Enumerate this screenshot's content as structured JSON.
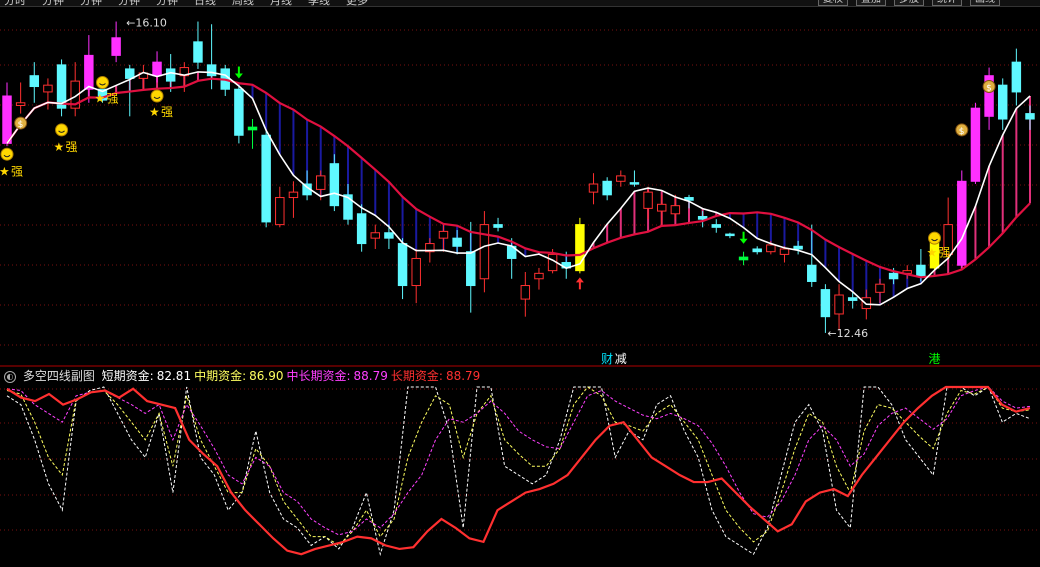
{
  "toolbar": {
    "left_items": [
      "分时",
      "分钟",
      "分钟",
      "分钟",
      "分钟",
      "日线",
      "周线",
      "月线",
      "季线",
      "更多"
    ],
    "right_items": [
      "复权",
      "叠加",
      "多股",
      "统计",
      "画线"
    ]
  },
  "main_panel": {
    "candles": [
      {
        "o": 135,
        "h": 145,
        "l": 98,
        "c": 100,
        "color": "magenta",
        "fill": true
      },
      {
        "o": 130,
        "h": 145,
        "l": 122,
        "c": 128,
        "color": "red",
        "fill": false
      },
      {
        "o": 142,
        "h": 160,
        "l": 130,
        "c": 150,
        "color": "cyan",
        "fill": true
      },
      {
        "o": 138,
        "h": 148,
        "l": 125,
        "c": 143,
        "color": "red",
        "fill": false
      },
      {
        "o": 158,
        "h": 162,
        "l": 120,
        "c": 126,
        "color": "cyan",
        "fill": true
      },
      {
        "o": 146,
        "h": 160,
        "l": 120,
        "c": 126,
        "color": "red",
        "fill": false
      },
      {
        "o": 140,
        "h": 180,
        "l": 130,
        "c": 165,
        "color": "magenta",
        "fill": true
      },
      {
        "o": 140,
        "h": 148,
        "l": 130,
        "c": 132,
        "color": "cyan",
        "fill": true
      },
      {
        "o": 178,
        "h": 190,
        "l": 160,
        "c": 165,
        "color": "magenta",
        "fill": true
      },
      {
        "o": 155,
        "h": 158,
        "l": 120,
        "c": 148,
        "color": "cyan",
        "fill": true
      },
      {
        "o": 148,
        "h": 158,
        "l": 140,
        "c": 152,
        "color": "red",
        "fill": false
      },
      {
        "o": 160,
        "h": 168,
        "l": 145,
        "c": 150,
        "color": "magenta",
        "fill": true
      },
      {
        "o": 155,
        "h": 166,
        "l": 138,
        "c": 146,
        "color": "cyan",
        "fill": true
      },
      {
        "o": 150,
        "h": 160,
        "l": 138,
        "c": 156,
        "color": "red",
        "fill": false
      },
      {
        "o": 175,
        "h": 190,
        "l": 155,
        "c": 160,
        "color": "cyan",
        "fill": true
      },
      {
        "o": 158,
        "h": 188,
        "l": 140,
        "c": 150,
        "color": "cyan",
        "fill": true
      },
      {
        "o": 155,
        "h": 158,
        "l": 135,
        "c": 140,
        "color": "cyan",
        "fill": true
      },
      {
        "o": 140,
        "h": 142,
        "l": 100,
        "c": 106,
        "color": "cyan",
        "fill": true
      },
      {
        "o": 112,
        "h": 118,
        "l": 96,
        "c": 110,
        "color": "green",
        "fill": true
      },
      {
        "o": 106,
        "h": 110,
        "l": 38,
        "c": 42,
        "color": "cyan",
        "fill": true
      },
      {
        "o": 40,
        "h": 68,
        "l": 38,
        "c": 60,
        "color": "red",
        "fill": false
      },
      {
        "o": 60,
        "h": 72,
        "l": 45,
        "c": 64,
        "color": "red",
        "fill": false
      },
      {
        "o": 70,
        "h": 80,
        "l": 58,
        "c": 62,
        "color": "cyan",
        "fill": true
      },
      {
        "o": 66,
        "h": 80,
        "l": 58,
        "c": 76,
        "color": "red",
        "fill": false
      },
      {
        "o": 85,
        "h": 92,
        "l": 50,
        "c": 54,
        "color": "cyan",
        "fill": true
      },
      {
        "o": 62,
        "h": 70,
        "l": 40,
        "c": 44,
        "color": "cyan",
        "fill": true
      },
      {
        "o": 48,
        "h": 55,
        "l": 20,
        "c": 26,
        "color": "cyan",
        "fill": true
      },
      {
        "o": 30,
        "h": 40,
        "l": 22,
        "c": 34,
        "color": "red",
        "fill": false
      },
      {
        "o": 30,
        "h": 40,
        "l": 22,
        "c": 34,
        "color": "cyan",
        "fill": true
      },
      {
        "o": 26,
        "h": 30,
        "l": -15,
        "c": -5,
        "color": "cyan",
        "fill": true
      },
      {
        "o": -5,
        "h": 22,
        "l": -18,
        "c": 15,
        "color": "red",
        "fill": false
      },
      {
        "o": 20,
        "h": 30,
        "l": 12,
        "c": 26,
        "color": "red",
        "fill": false
      },
      {
        "o": 30,
        "h": 40,
        "l": 20,
        "c": 35,
        "color": "red",
        "fill": false
      },
      {
        "o": 30,
        "h": 36,
        "l": 18,
        "c": 24,
        "color": "cyan",
        "fill": true
      },
      {
        "o": 20,
        "h": 42,
        "l": -25,
        "c": -5,
        "color": "cyan",
        "fill": true
      },
      {
        "o": 0,
        "h": 50,
        "l": -10,
        "c": 40,
        "color": "red",
        "fill": false
      },
      {
        "o": 40,
        "h": 45,
        "l": 35,
        "c": 38,
        "color": "cyan",
        "fill": true
      },
      {
        "o": 15,
        "h": 30,
        "l": 0,
        "c": 24,
        "color": "cyan",
        "fill": true
      },
      {
        "o": -5,
        "h": 5,
        "l": -28,
        "c": -15,
        "color": "red",
        "fill": false
      },
      {
        "o": 0,
        "h": 8,
        "l": -8,
        "c": 4,
        "color": "red",
        "fill": false
      },
      {
        "o": 6,
        "h": 22,
        "l": 4,
        "c": 18,
        "color": "red",
        "fill": false
      },
      {
        "o": 12,
        "h": 20,
        "l": 0,
        "c": 8,
        "color": "cyan",
        "fill": true
      },
      {
        "o": 6,
        "h": 45,
        "l": 4,
        "c": 40,
        "color": "yellow",
        "fill": true
      },
      {
        "o": 70,
        "h": 78,
        "l": 55,
        "c": 64,
        "color": "red",
        "fill": false
      },
      {
        "o": 62,
        "h": 75,
        "l": 58,
        "c": 72,
        "color": "cyan",
        "fill": true
      },
      {
        "o": 72,
        "h": 80,
        "l": 68,
        "c": 76,
        "color": "red",
        "fill": false
      },
      {
        "o": 70,
        "h": 80,
        "l": 68,
        "c": 71,
        "color": "cyan",
        "fill": true
      },
      {
        "o": 64,
        "h": 68,
        "l": 44,
        "c": 52,
        "color": "red",
        "fill": false
      },
      {
        "o": 50,
        "h": 62,
        "l": 40,
        "c": 55,
        "color": "red",
        "fill": false
      },
      {
        "o": 54,
        "h": 62,
        "l": 44,
        "c": 48,
        "color": "red",
        "fill": false
      },
      {
        "o": 58,
        "h": 62,
        "l": 52,
        "c": 60,
        "color": "cyan",
        "fill": true
      },
      {
        "o": 46,
        "h": 50,
        "l": 38,
        "c": 44,
        "color": "cyan",
        "fill": true
      },
      {
        "o": 40,
        "h": 44,
        "l": 34,
        "c": 38,
        "color": "cyan",
        "fill": true
      },
      {
        "o": 32,
        "h": 34,
        "l": 30,
        "c": 33,
        "color": "cyan",
        "fill": true
      },
      {
        "o": 16,
        "h": 20,
        "l": 10,
        "c": 14,
        "color": "green",
        "fill": true
      },
      {
        "o": 22,
        "h": 24,
        "l": 18,
        "c": 20,
        "color": "cyan",
        "fill": true
      },
      {
        "o": 20,
        "h": 28,
        "l": 18,
        "c": 25,
        "color": "red",
        "fill": false
      },
      {
        "o": 18,
        "h": 24,
        "l": 12,
        "c": 22,
        "color": "red",
        "fill": false
      },
      {
        "o": 22,
        "h": 28,
        "l": 18,
        "c": 24,
        "color": "cyan",
        "fill": true
      },
      {
        "o": 10,
        "h": 40,
        "l": -6,
        "c": -2,
        "color": "cyan",
        "fill": true
      },
      {
        "o": -8,
        "h": -4,
        "l": -40,
        "c": -28,
        "color": "cyan",
        "fill": true
      },
      {
        "o": -12,
        "h": -4,
        "l": -38,
        "c": -26,
        "color": "red",
        "fill": false
      },
      {
        "o": -14,
        "h": -10,
        "l": -22,
        "c": -16,
        "color": "cyan",
        "fill": true
      },
      {
        "o": -14,
        "h": -8,
        "l": -30,
        "c": -22,
        "color": "red",
        "fill": false
      },
      {
        "o": -10,
        "h": 0,
        "l": -18,
        "c": -4,
        "color": "red",
        "fill": false
      },
      {
        "o": 4,
        "h": 8,
        "l": -4,
        "c": 0,
        "color": "cyan",
        "fill": true
      },
      {
        "o": 4,
        "h": 10,
        "l": 0,
        "c": 6,
        "color": "red",
        "fill": false
      },
      {
        "o": 10,
        "h": 22,
        "l": -2,
        "c": 2,
        "color": "cyan",
        "fill": true
      },
      {
        "o": 8,
        "h": 34,
        "l": 6,
        "c": 28,
        "color": "yellow",
        "fill": true
      },
      {
        "o": 18,
        "h": 60,
        "l": 14,
        "c": 40,
        "color": "red",
        "fill": false
      },
      {
        "o": 10,
        "h": 80,
        "l": 8,
        "c": 72,
        "color": "magenta",
        "fill": true
      },
      {
        "o": 72,
        "h": 130,
        "l": 70,
        "c": 126,
        "color": "magenta",
        "fill": true
      },
      {
        "o": 120,
        "h": 156,
        "l": 110,
        "c": 150,
        "color": "magenta",
        "fill": true
      },
      {
        "o": 118,
        "h": 148,
        "l": 110,
        "c": 143,
        "color": "cyan",
        "fill": true
      },
      {
        "o": 160,
        "h": 170,
        "l": 128,
        "c": 138,
        "color": "cyan",
        "fill": true
      },
      {
        "o": 122,
        "h": 128,
        "l": 110,
        "c": 118,
        "color": "cyan",
        "fill": true
      }
    ],
    "price_high_label": "16.10",
    "price_low_label": "12.46",
    "signs": [
      {
        "index": 0,
        "kind": "face",
        "y_price": 92
      },
      {
        "index": 0,
        "kind": "star",
        "y_price": 80,
        "label": "强"
      },
      {
        "index": 4,
        "kind": "face",
        "y_price": 110
      },
      {
        "index": 4,
        "kind": "star",
        "y_price": 98,
        "label": "强"
      },
      {
        "index": 7,
        "kind": "face",
        "y_price": 145
      },
      {
        "index": 7,
        "kind": "star",
        "y_price": 134,
        "label": "强"
      },
      {
        "index": 11,
        "kind": "face",
        "y_price": 135
      },
      {
        "index": 11,
        "kind": "star",
        "y_price": 124,
        "label": "强"
      },
      {
        "index": 68,
        "kind": "face",
        "y_price": 30
      },
      {
        "index": 68,
        "kind": "star",
        "y_price": 20,
        "label": "强"
      },
      {
        "index": 1,
        "kind": "money",
        "y_price": 115
      },
      {
        "index": 70,
        "kind": "money",
        "y_price": 110
      },
      {
        "index": 72,
        "kind": "money",
        "y_price": 142
      }
    ],
    "arrows": [
      {
        "index": 17,
        "dir": "down",
        "color": "#00ff00"
      },
      {
        "index": 42,
        "dir": "up",
        "color": "#ff3030"
      },
      {
        "index": 54,
        "dir": "down",
        "color": "#00ff00"
      }
    ],
    "footer_tags": [
      {
        "index": 44,
        "text": "财",
        "color": "#00e5ff"
      },
      {
        "index": 45,
        "text": "减",
        "color": "#ffffff"
      },
      {
        "index": 68,
        "text": "港",
        "color": "#00ff00"
      }
    ]
  },
  "sub_panel": {
    "title": "多空四线副图",
    "indicators": [
      {
        "label": "短期资金:",
        "value": "82.81",
        "color": "#ffffff"
      },
      {
        "label": "中期资金:",
        "value": "86.90",
        "color": "#ffff60"
      },
      {
        "label": "中长期资金:",
        "value": "88.79",
        "color": "#ff40ff"
      },
      {
        "label": "长期资金:",
        "value": "88.79",
        "color": "#ff3030"
      }
    ]
  },
  "chart_data": {
    "type": "line",
    "title": "多空四线副图",
    "series": [
      {
        "name": "短期资金",
        "color": "#ffffff",
        "values": [
          95,
          90,
          70,
          45,
          30,
          92,
          98,
          100,
          85,
          70,
          60,
          85,
          40,
          100,
          60,
          50,
          30,
          40,
          75,
          40,
          25,
          20,
          10,
          15,
          8,
          20,
          40,
          5,
          30,
          100,
          100,
          100,
          75,
          20,
          100,
          100,
          55,
          50,
          45,
          50,
          70,
          100,
          100,
          100,
          60,
          75,
          70,
          90,
          95,
          75,
          60,
          30,
          15,
          10,
          5,
          20,
          50,
          80,
          90,
          75,
          30,
          20,
          100,
          100,
          90,
          70,
          60,
          50,
          100,
          100,
          95,
          100,
          80,
          85,
          82
        ]
      },
      {
        "name": "中期资金",
        "color": "#ffff60",
        "values": [
          98,
          96,
          80,
          60,
          50,
          93,
          97,
          98,
          90,
          80,
          70,
          85,
          55,
          95,
          70,
          55,
          40,
          40,
          65,
          55,
          35,
          25,
          15,
          15,
          10,
          18,
          30,
          15,
          25,
          60,
          80,
          95,
          90,
          60,
          85,
          95,
          70,
          62,
          55,
          55,
          65,
          90,
          100,
          95,
          80,
          78,
          75,
          85,
          90,
          80,
          70,
          50,
          30,
          20,
          12,
          18,
          40,
          65,
          85,
          80,
          55,
          40,
          75,
          90,
          88,
          80,
          72,
          65,
          85,
          98,
          96,
          100,
          88,
          86,
          87
        ]
      },
      {
        "name": "中长期资金",
        "color": "#ff40ff",
        "values": [
          99,
          98,
          90,
          85,
          80,
          95,
          97,
          98,
          94,
          90,
          85,
          90,
          70,
          90,
          78,
          65,
          50,
          45,
          60,
          55,
          40,
          35,
          25,
          20,
          16,
          18,
          25,
          20,
          28,
          40,
          50,
          70,
          82,
          80,
          85,
          92,
          85,
          75,
          70,
          66,
          65,
          80,
          95,
          98,
          92,
          88,
          84,
          82,
          85,
          82,
          78,
          68,
          55,
          40,
          28,
          26,
          35,
          50,
          70,
          78,
          70,
          55,
          62,
          78,
          85,
          88,
          82,
          76,
          82,
          95,
          98,
          100,
          92,
          88,
          89
        ]
      },
      {
        "name": "长期资金",
        "color": "#ff3030",
        "values": [
          99,
          94,
          92,
          96,
          90,
          93,
          97,
          98,
          94,
          99,
          92,
          90,
          88,
          70,
          62,
          55,
          40,
          30,
          22,
          14,
          7,
          5,
          8,
          10,
          12,
          15,
          14,
          10,
          8,
          9,
          18,
          25,
          20,
          14,
          12,
          30,
          35,
          40,
          42,
          45,
          50,
          60,
          70,
          78,
          80,
          70,
          60,
          55,
          50,
          46,
          46,
          48,
          40,
          32,
          25,
          18,
          22,
          35,
          40,
          42,
          38,
          50,
          60,
          70,
          80,
          88,
          95,
          100,
          100,
          100,
          100,
          90,
          86,
          88
        ]
      }
    ],
    "ylim": [
      0,
      100
    ]
  }
}
